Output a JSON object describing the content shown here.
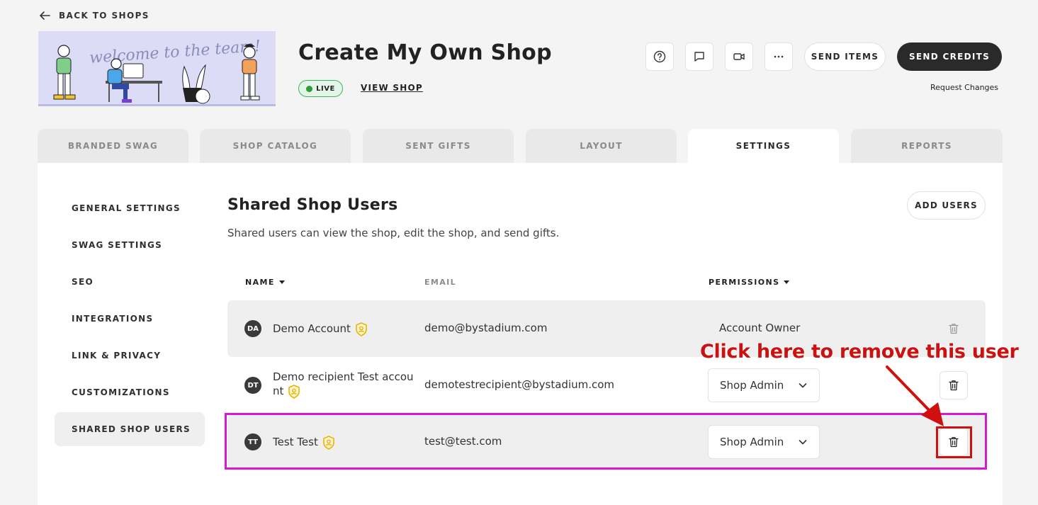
{
  "nav": {
    "back_label": "BACK TO SHOPS"
  },
  "banner": {
    "text": "welcome to the team!"
  },
  "shop": {
    "title": "Create My Own Shop",
    "status": "LIVE",
    "view_label": "VIEW SHOP"
  },
  "header_actions": {
    "icons": [
      "help-icon",
      "chat-icon",
      "video-icon",
      "more-icon"
    ],
    "send_items": "SEND ITEMS",
    "send_credits": "SEND CREDITS",
    "request_changes": "Request Changes"
  },
  "tabs": [
    {
      "label": "BRANDED SWAG"
    },
    {
      "label": "SHOP CATALOG"
    },
    {
      "label": "SENT GIFTS"
    },
    {
      "label": "LAYOUT"
    },
    {
      "label": "SETTINGS",
      "active": true
    },
    {
      "label": "REPORTS"
    }
  ],
  "sidebar": {
    "items": [
      {
        "label": "GENERAL SETTINGS"
      },
      {
        "label": "SWAG SETTINGS"
      },
      {
        "label": "SEO"
      },
      {
        "label": "INTEGRATIONS"
      },
      {
        "label": "LINK & PRIVACY"
      },
      {
        "label": "CUSTOMIZATIONS"
      },
      {
        "label": "SHARED SHOP USERS",
        "active": true
      }
    ]
  },
  "section": {
    "title": "Shared Shop Users",
    "description": "Shared users can view the shop, edit the shop, and send gifts.",
    "add_users": "ADD USERS"
  },
  "table": {
    "headers": {
      "name": "NAME",
      "email": "EMAIL",
      "permissions": "PERMISSIONS"
    },
    "rows": [
      {
        "initials": "DA",
        "name": "Demo Account",
        "email": "demo@bystadium.com",
        "permission": "Account Owner",
        "editable": false
      },
      {
        "initials": "DT",
        "name_line1": "Demo recipient Test accou",
        "name_line2": "nt",
        "email": "demotestrecipient@bystadium.com",
        "permission": "Shop Admin",
        "editable": true
      },
      {
        "initials": "TT",
        "name": "Test Test",
        "email": "test@test.com",
        "permission": "Shop Admin",
        "editable": true
      }
    ]
  },
  "annotation": {
    "text": "Click here to remove this user",
    "color": "#cc1111",
    "highlight_color": "#d61ad1"
  },
  "colors": {
    "primary_dark": "#2a2a2a",
    "live_green": "#2e9e3b",
    "badge_gold": "#e8b400"
  }
}
